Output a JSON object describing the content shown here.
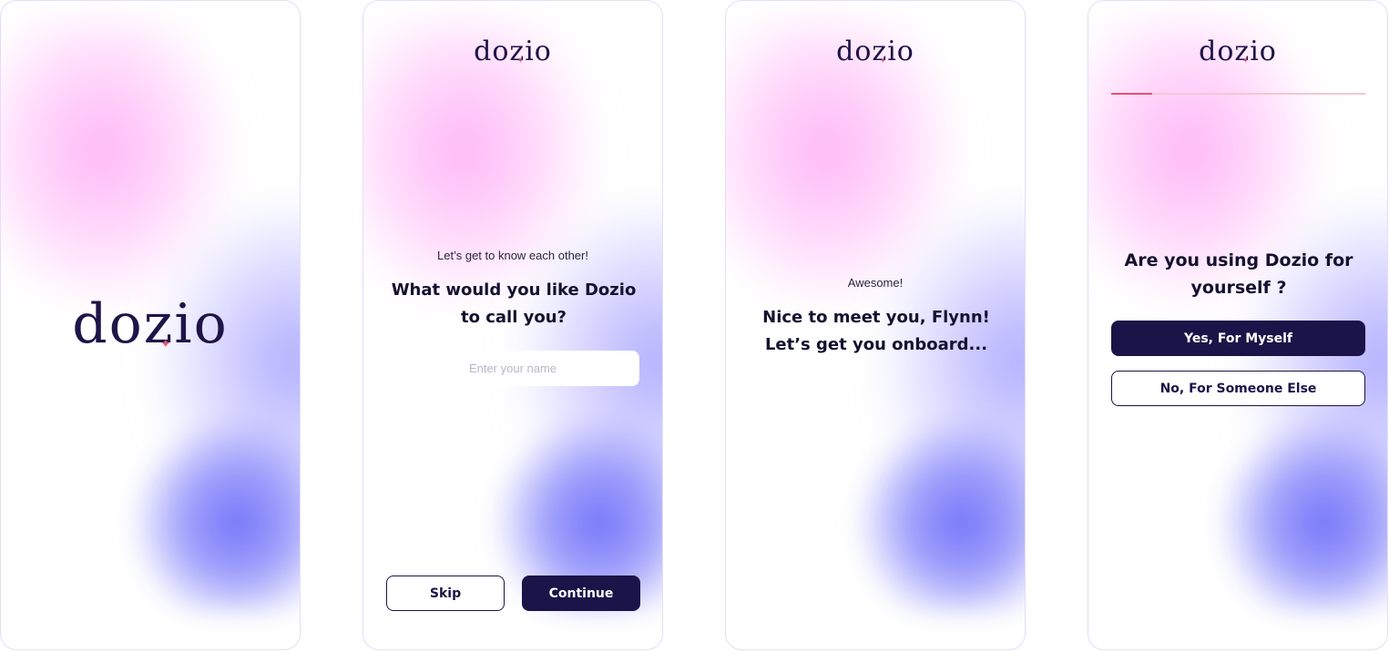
{
  "brand": {
    "name": "dozio",
    "text_color": "#1e1448",
    "accent": "#e4526f"
  },
  "screens": {
    "splash": {
      "logo": "dozio"
    },
    "name_step": {
      "logo": "dozio",
      "kicker": "Let’s get to know each other!",
      "question_line1": "What would you like Dozio",
      "question_line2": "to call you?",
      "name_input": {
        "value": "",
        "placeholder": "Enter your name"
      },
      "skip_label": "Skip",
      "continue_label": "Continue"
    },
    "greeting": {
      "logo": "dozio",
      "kicker": "Awesome!",
      "line1": "Nice to meet you, Flynn!",
      "line2": "Let’s get you onboard..."
    },
    "usage_step": {
      "logo": "dozio",
      "progress_fraction": 0.16,
      "question_line1": "Are you using Dozio for",
      "question_line2": "yourself ?",
      "option_yes": "Yes, For Myself",
      "option_no": "No, For Someone Else"
    }
  },
  "colors": {
    "primary_button": "#1b1448",
    "pink_glow": "#ffb3f5",
    "purple_glow": "#7474f8"
  }
}
